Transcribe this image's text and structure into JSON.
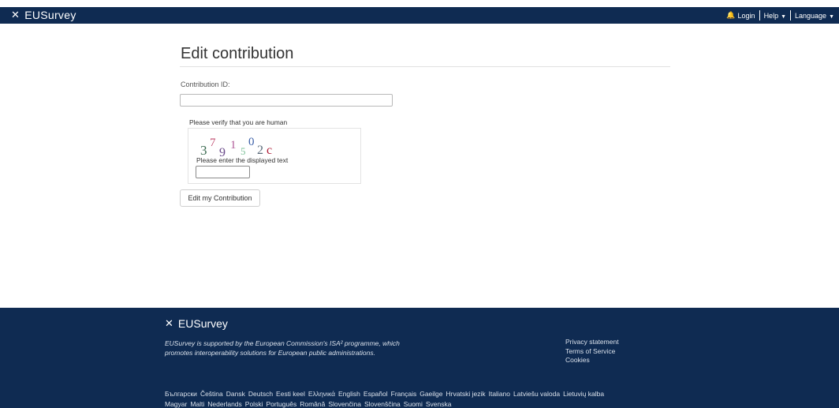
{
  "header": {
    "brand": "EUSurvey",
    "login": "Login",
    "help": "Help",
    "language": "Language"
  },
  "main": {
    "title": "Edit contribution",
    "contribution_id_label": "Contribution ID:",
    "contribution_id_value": "",
    "captcha": {
      "title": "Please verify that you are human",
      "chars": [
        "3",
        "7",
        "9",
        "1",
        "5",
        "0",
        "2",
        "c"
      ],
      "label": "Please enter the displayed text",
      "value": ""
    },
    "submit_label": "Edit my Contribution"
  },
  "footer": {
    "brand": "EUSurvey",
    "description": "EUSurvey is supported by the European Commission's ISA² programme, which promotes interoperability solutions for European public administrations.",
    "links": [
      "Privacy statement",
      "Terms of Service",
      "Cookies"
    ],
    "languages_row1": [
      "Български",
      "Čeština",
      "Dansk",
      "Deutsch",
      "Eesti keel",
      "Ελληνικά",
      "English",
      "Español",
      "Français",
      "Gaeilge",
      "Hrvatski jezik",
      "Italiano",
      "Latviešu valoda",
      "Lietuvių kalba"
    ],
    "languages_row2": [
      "Magyar",
      "Malti",
      "Nederlands",
      "Polski",
      "Português",
      "Română",
      "Slovenčina",
      "Slovenščina",
      "Suomi",
      "Svenska"
    ]
  },
  "colors": {
    "navy": "#0f2b52"
  }
}
